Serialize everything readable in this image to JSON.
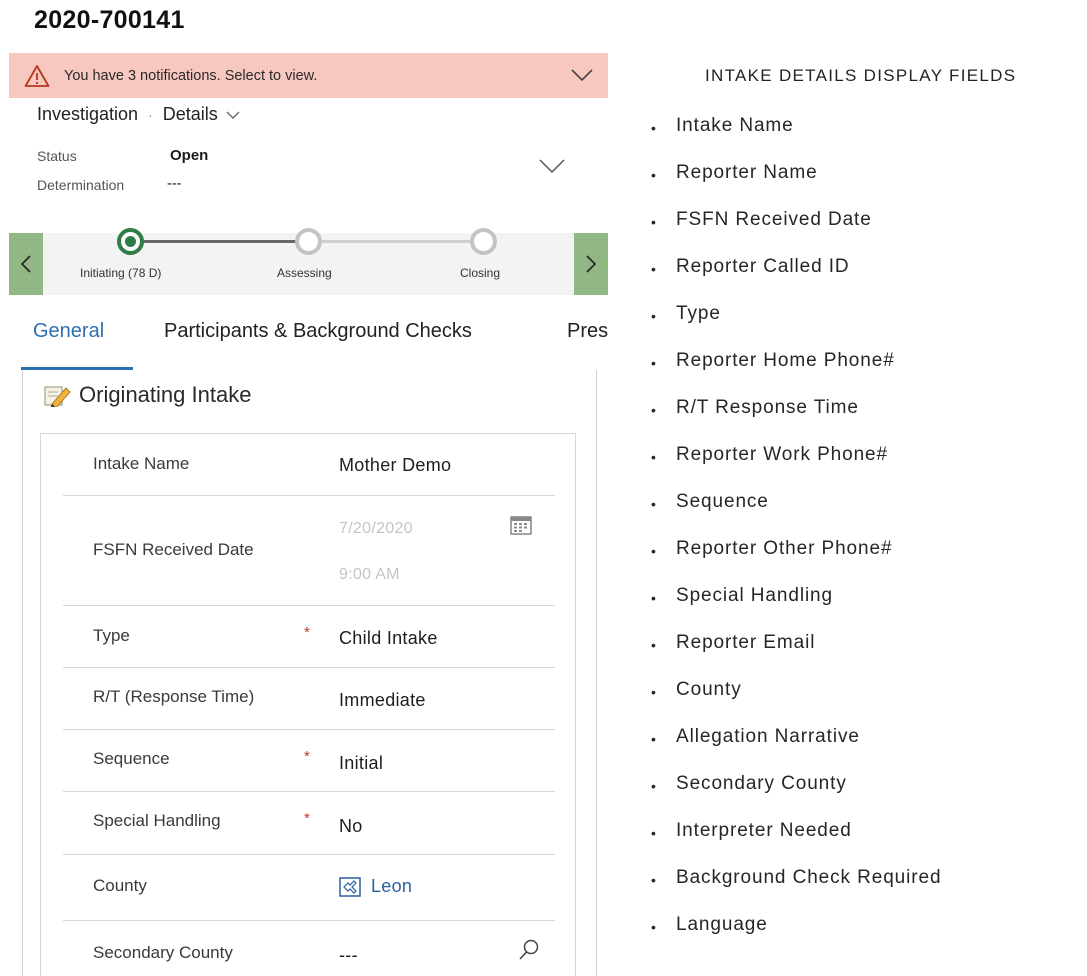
{
  "record": {
    "title": "2020-700141"
  },
  "notification": {
    "text": "You have 3 notifications. Select to view."
  },
  "header": {
    "entity": "Investigation",
    "form": "Details",
    "fields": [
      {
        "label": "Status",
        "value": "Open"
      },
      {
        "label": "Determination",
        "value": "---"
      }
    ]
  },
  "process": {
    "stages": [
      {
        "label": "Initiating  (78 D)",
        "state": "active"
      },
      {
        "label": "Assessing",
        "state": "inactive"
      },
      {
        "label": "Closing",
        "state": "inactive"
      }
    ]
  },
  "tabs": [
    {
      "label": "General",
      "active": true
    },
    {
      "label": "Participants & Background Checks",
      "active": false
    },
    {
      "label": "Pres",
      "active": false
    }
  ],
  "section": {
    "title": "Originating Intake",
    "fields": [
      {
        "label": "Intake Name",
        "value": "Mother  Demo",
        "required": false
      },
      {
        "label": "FSFN Received Date",
        "date": "7/20/2020",
        "time": "9:00 AM",
        "icon": "calendar-icon"
      },
      {
        "label": "Type",
        "value": "Child Intake",
        "required": true
      },
      {
        "label": "R/T (Response Time)",
        "value": "Immediate",
        "required": false
      },
      {
        "label": "Sequence",
        "value": "Initial",
        "required": true
      },
      {
        "label": "Special Handling",
        "value": "No",
        "required": true
      },
      {
        "label": "County",
        "value": "Leon",
        "icon": "lookup-entity-icon"
      },
      {
        "label": "Secondary County",
        "value": "---",
        "icon": "search-icon"
      }
    ],
    "required_marker": "*"
  },
  "display_fields": {
    "title": "INTAKE DETAILS DISPLAY FIELDS",
    "bullet": "•",
    "items": [
      "Intake Name",
      "Reporter Name",
      "FSFN Received Date",
      "Reporter Called ID",
      "Type",
      "Reporter Home Phone#",
      "R/T Response Time",
      "Reporter Work Phone#",
      "Sequence",
      "Reporter Other Phone#",
      "Special Handling",
      "Reporter Email",
      "County",
      "Allegation Narrative",
      "Secondary County",
      "Interpreter Needed",
      "Background Check Required",
      "Language"
    ]
  },
  "colors": {
    "notification_bg": "#f7c8bf",
    "process_nav": "#91b784",
    "active_stage": "#2f7d47",
    "active_tab": "#2e6fb0",
    "required": "#c0392b",
    "link": "#2a5f9e"
  }
}
